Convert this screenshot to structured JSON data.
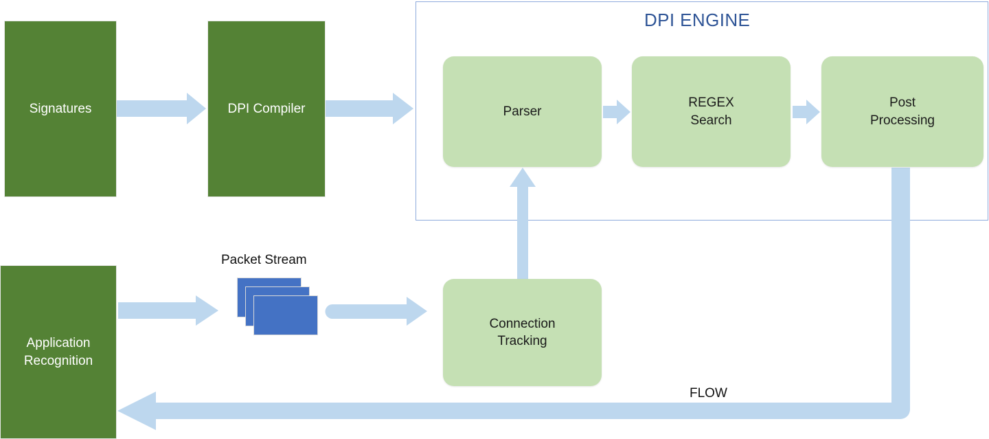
{
  "diagram": {
    "title_label": "DPI ENGINE",
    "accent_colors": {
      "dark_green": "#548235",
      "light_green": "#C5E0B4",
      "arrow_blue": "#BDD7EE",
      "packet_blue": "#4472C4",
      "frame_blue": "#8FAADC",
      "title_blue": "#2E5496"
    },
    "boxes": {
      "signatures": {
        "label": "Signatures"
      },
      "dpi_compiler": {
        "label": "DPI Compiler"
      },
      "application_recognition": {
        "label_line1": "Application",
        "label_line2": "Recognition"
      },
      "parser": {
        "label": "Parser"
      },
      "regex_search": {
        "label_line1": "REGEX",
        "label_line2": "Search"
      },
      "post_processing": {
        "label_line1": "Post",
        "label_line2": "Processing"
      },
      "connection_tracking": {
        "label_line1": "Connection",
        "label_line2": "Tracking"
      }
    },
    "labels": {
      "packet_stream": "Packet Stream",
      "flow": "FLOW"
    }
  }
}
